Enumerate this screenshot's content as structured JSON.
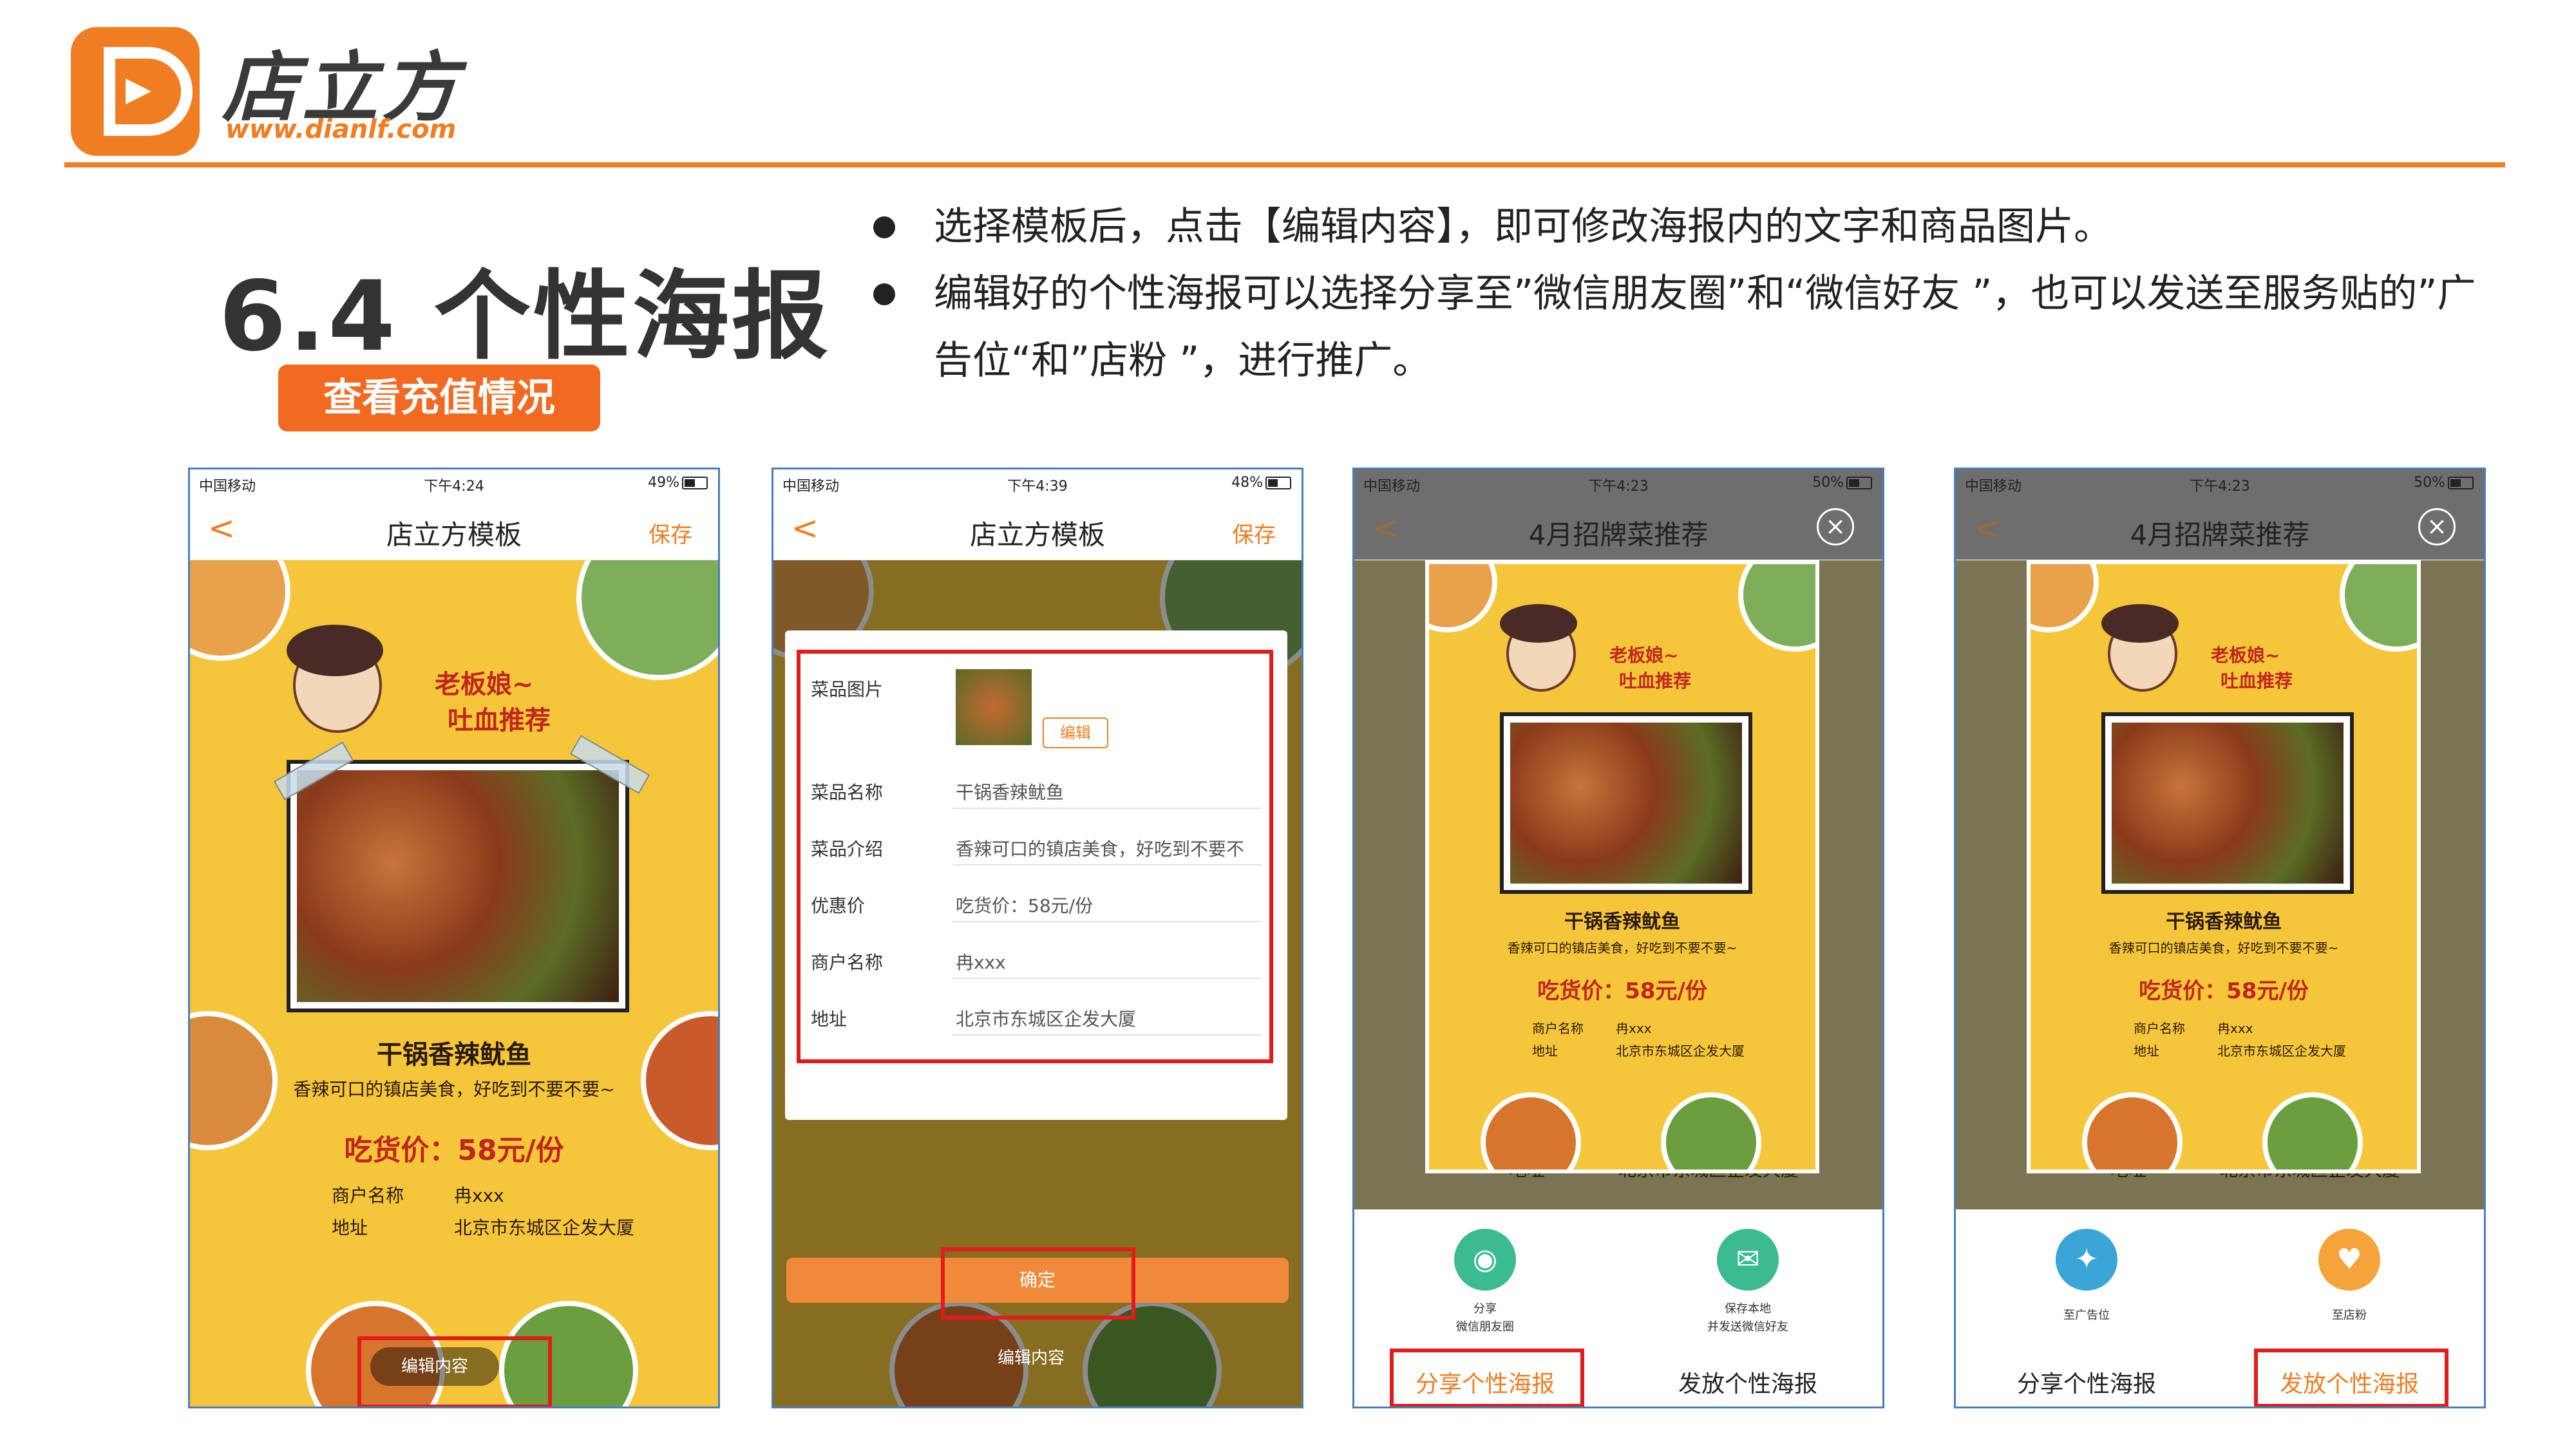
{
  "brand": {
    "name": "店立方",
    "url": "www.dianlf.com"
  },
  "section": {
    "title": "6.4 个性海报",
    "button": "查看充值情况"
  },
  "bullets": [
    "选择模板后，点击【编辑内容】，即可修改海报内的文字和商品图片。",
    "编辑好的个性海报可以选择分享至”微信朋友圈”和“微信好友 ”，也可以发送至服务贴的”广告位“和”店粉 ”，进行推广。"
  ],
  "colors": {
    "accent": "#f07d22",
    "poster_bg": "#f6c63a",
    "highlight_box": "#e21b1b",
    "share_green": "#3cba92",
    "share_blue": "#3aa6d8",
    "share_orange": "#f4a43a"
  },
  "phones": [
    {
      "carrier": "中国移动",
      "time": "下午4:24",
      "battery": "49%",
      "battery_level": 0.49,
      "nav_back": "<",
      "nav_title": "店立方模板",
      "nav_save": "保存",
      "poster": {
        "bubble1": "老板娘~",
        "bubble2": "吐血推荐",
        "dish": "干锅香辣鱿鱼",
        "desc": "香辣可口的镇店美食，好吃到不要不要~",
        "price": "吃货价：58元/份",
        "merchant_label": "商户名称",
        "merchant": "冉xxx",
        "address_label": "地址",
        "address": "北京市东城区企发大厦",
        "edit_button": "编辑内容"
      }
    },
    {
      "carrier": "中国移动",
      "time": "下午4:39",
      "battery": "48%",
      "battery_level": 0.48,
      "nav_back": "<",
      "nav_title": "店立方模板",
      "nav_save": "保存",
      "form": {
        "image_label": "菜品图片",
        "edit_label": "编辑",
        "rows": [
          {
            "label": "菜品名称",
            "value": "干锅香辣鱿鱼"
          },
          {
            "label": "菜品介绍",
            "value": "香辣可口的镇店美食，好吃到不要不"
          },
          {
            "label": "优惠价",
            "value": "吃货价：58元/份"
          },
          {
            "label": "商户名称",
            "value": "冉xxx"
          },
          {
            "label": "地址",
            "value": "北京市东城区企发大厦"
          }
        ],
        "confirm": "确定",
        "behind_button": "编辑内容"
      }
    },
    {
      "carrier": "中国移动",
      "time": "下午4:23",
      "battery": "50%",
      "battery_level": 0.5,
      "nav_back": "<",
      "nav_title": "4月招牌菜推荐",
      "close": "×",
      "poster": {
        "bubble1": "老板娘~",
        "bubble2": "吐血推荐",
        "dish": "干锅香辣鱿鱼",
        "desc": "香辣可口的镇店美食，好吃到不要不要~",
        "price": "吃货价：58元/份",
        "merchant_label": "商户名称",
        "merchant": "冉xxx",
        "address_label": "地址",
        "address": "北京市东城区企发大厦"
      },
      "behind": {
        "address_label": "地址",
        "address": "北京市东城区企发大厦"
      },
      "actions": [
        {
          "line1": "分享",
          "line2": "微信朋友圈"
        },
        {
          "line1": "保存本地",
          "line2": "并发送微信好友"
        }
      ],
      "tabs": [
        "分享个性海报",
        "发放个性海报"
      ],
      "active_tab": 0
    },
    {
      "carrier": "中国移动",
      "time": "下午4:23",
      "battery": "50%",
      "battery_level": 0.5,
      "nav_back": "<",
      "nav_title": "4月招牌菜推荐",
      "close": "×",
      "poster": {
        "bubble1": "老板娘~",
        "bubble2": "吐血推荐",
        "dish": "干锅香辣鱿鱼",
        "desc": "香辣可口的镇店美食，好吃到不要不要~",
        "price": "吃货价：58元/份",
        "merchant_label": "商户名称",
        "merchant": "冉xxx",
        "address_label": "地址",
        "address": "北京市东城区企发大厦"
      },
      "behind": {
        "address_label": "地址",
        "address": "北京市东城区企发大厦"
      },
      "actions": [
        {
          "line1": "至广告位"
        },
        {
          "line1": "至店粉"
        }
      ],
      "tabs": [
        "分享个性海报",
        "发放个性海报"
      ],
      "active_tab": 1
    }
  ]
}
